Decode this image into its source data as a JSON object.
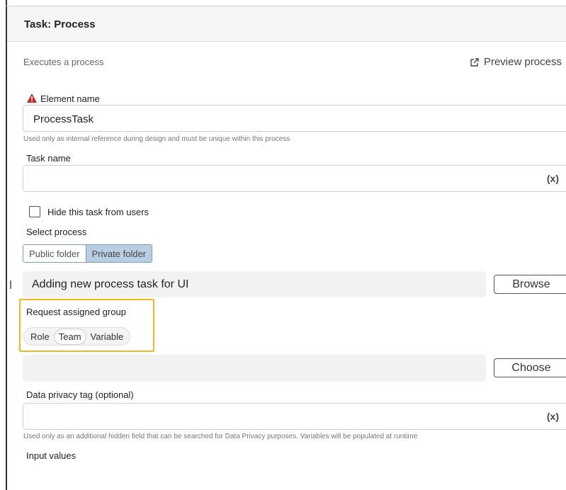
{
  "header": {
    "title": "Task: Process"
  },
  "description": "Executes a process",
  "preview": {
    "label": "Preview process",
    "icon": "external-link-icon"
  },
  "element_name": {
    "label": "Element name",
    "value": "ProcessTask",
    "help": "Used only as internal reference during design and must be unique within this process",
    "icon": "warning-icon",
    "icon_color": "#c62828"
  },
  "task_name": {
    "label": "Task name",
    "value": "",
    "variable_label": "(x)"
  },
  "hide_task": {
    "label": "Hide this task from users",
    "checked": false
  },
  "select_process": {
    "label": "Select process",
    "tabs": [
      {
        "label": "Public folder",
        "active": false
      },
      {
        "label": "Private folder",
        "active": true
      }
    ],
    "value": "Adding new process task for UI",
    "browse_label": "Browse"
  },
  "request_group": {
    "label": "Request assigned group",
    "options": [
      {
        "label": "Role",
        "active": false
      },
      {
        "label": "Team",
        "active": true
      },
      {
        "label": "Variable",
        "active": false
      }
    ],
    "value": "",
    "choose_label": "Choose",
    "highlight_color": "#f5b526"
  },
  "data_privacy": {
    "label": "Data privacy tag (optional)",
    "value": "",
    "variable_label": "(x)",
    "help": "Used only as an additional hidden field that can be searched for Data Privacy purposes. Variables will be populated at runtime"
  },
  "input_values": {
    "label": "Input values"
  }
}
